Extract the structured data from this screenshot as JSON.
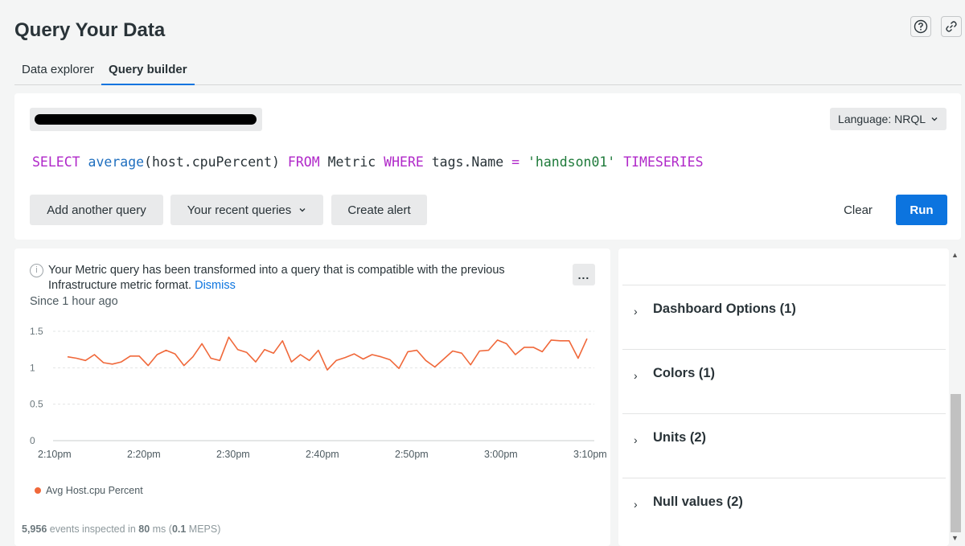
{
  "page": {
    "title": "Query Your Data"
  },
  "header_icons": {
    "help": "question-circle-icon",
    "link": "link-icon"
  },
  "tabs": [
    {
      "label": "Data explorer",
      "active": false
    },
    {
      "label": "Query builder",
      "active": true
    }
  ],
  "query": {
    "language_label": "Language: NRQL",
    "nrql": "SELECT average(host.cpuPercent) FROM Metric WHERE tags.Name = 'handson01' TIMESERIES",
    "add_label": "Add another query",
    "recent_label": "Your recent queries",
    "alert_label": "Create alert",
    "clear_label": "Clear",
    "run_label": "Run"
  },
  "notice": {
    "text": "Your Metric query has been transformed into a query that is compatible with the previous Infrastructure metric format.",
    "dismiss": "Dismiss",
    "more": "..."
  },
  "since": "Since 1 hour ago",
  "chart_data": {
    "type": "line",
    "x": [
      "2:10pm",
      "2:20pm",
      "2:30pm",
      "2:40pm",
      "2:50pm",
      "3:00pm",
      "3:10pm"
    ],
    "y_ticks": [
      "1.5",
      "1",
      "0.5",
      "0"
    ],
    "ylim": [
      0,
      1.5
    ],
    "series": [
      {
        "name": "Avg Host.cpu Percent",
        "color": "#f0683a",
        "values": [
          1.15,
          1.13,
          1.1,
          1.18,
          1.07,
          1.05,
          1.08,
          1.16,
          1.16,
          1.03,
          1.18,
          1.24,
          1.19,
          1.03,
          1.15,
          1.33,
          1.13,
          1.1,
          1.42,
          1.25,
          1.21,
          1.08,
          1.25,
          1.2,
          1.37,
          1.08,
          1.18,
          1.1,
          1.24,
          0.97,
          1.1,
          1.14,
          1.19,
          1.12,
          1.18,
          1.15,
          1.11,
          0.99,
          1.22,
          1.24,
          1.1,
          1.01,
          1.12,
          1.23,
          1.2,
          1.04,
          1.23,
          1.24,
          1.38,
          1.33,
          1.18,
          1.28,
          1.28,
          1.22,
          1.38,
          1.37,
          1.37,
          1.13,
          1.4
        ]
      }
    ],
    "grid": true,
    "legend": "bottom-left"
  },
  "legend_label": "Avg Host.cpu Percent",
  "stats": {
    "events": "5,956",
    "events_suffix": " events inspected in ",
    "ms": "80",
    "ms_suffix": " ms (",
    "meps": "0.1",
    "meps_suffix": " MEPS)"
  },
  "options": [
    {
      "label": "Dashboard Options (1)"
    },
    {
      "label": "Colors (1)"
    },
    {
      "label": "Units (2)"
    },
    {
      "label": "Null values (2)"
    }
  ]
}
